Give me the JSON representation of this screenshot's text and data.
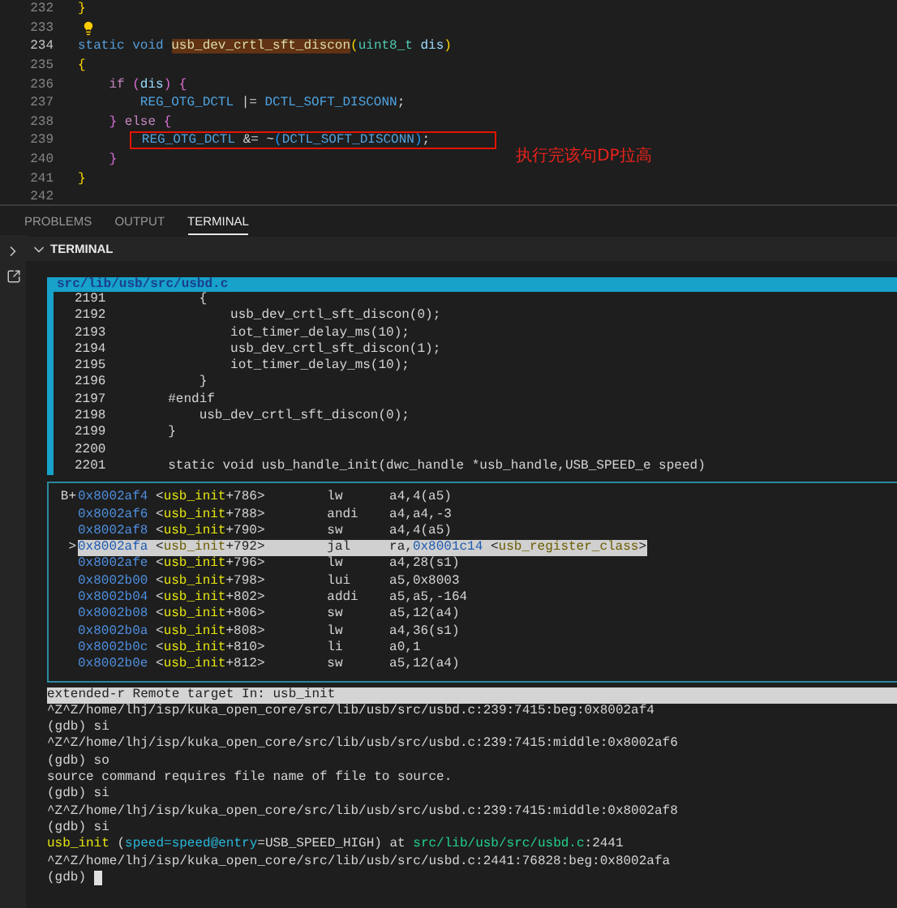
{
  "editor": {
    "lines": [
      {
        "number": "232",
        "kind": "code",
        "current": false,
        "tokens": [
          {
            "text": "}",
            "kind": "bracket1"
          }
        ]
      },
      {
        "number": "233",
        "kind": "hint",
        "current": false
      },
      {
        "number": "234",
        "kind": "code",
        "current": true,
        "tokens": [
          {
            "text": "static void ",
            "kind": "keyword"
          },
          {
            "text": "usb_dev_crtl_sft_discon",
            "kind": "function-match"
          },
          {
            "text": "(",
            "kind": "bracket1"
          },
          {
            "text": "uint8_t",
            "kind": "type"
          },
          {
            "text": " dis",
            "kind": "variable"
          },
          {
            "text": ")",
            "kind": "bracket1"
          }
        ]
      },
      {
        "number": "235",
        "kind": "code",
        "current": false,
        "tokens": [
          {
            "text": "{",
            "kind": "bracket1"
          }
        ]
      },
      {
        "number": "236",
        "kind": "code",
        "current": false,
        "tokens": [
          {
            "text": "    if",
            "kind": "control"
          },
          {
            "text": " (",
            "kind": "bracket2"
          },
          {
            "text": "dis",
            "kind": "variable"
          },
          {
            "text": ") {",
            "kind": "bracket2"
          }
        ]
      },
      {
        "number": "237",
        "kind": "code",
        "current": false,
        "tokens": [
          {
            "text": "        REG_OTG_DCTL",
            "kind": "macro"
          },
          {
            "text": " |= ",
            "kind": "plain"
          },
          {
            "text": "DCTL_SOFT_DISCONN",
            "kind": "macro"
          },
          {
            "text": ";",
            "kind": "plain"
          }
        ]
      },
      {
        "number": "238",
        "kind": "code",
        "current": false,
        "tokens": [
          {
            "text": "    }",
            "kind": "bracket2"
          },
          {
            "text": " else",
            "kind": "control"
          },
          {
            "text": " {",
            "kind": "bracket2"
          }
        ]
      },
      {
        "number": "239",
        "kind": "code",
        "current": false,
        "boxed": true,
        "note": "执行完该句DP拉高",
        "tokens": [
          {
            "text": "        REG_OTG_DCTL",
            "kind": "macro"
          },
          {
            "text": " &= ~",
            "kind": "plain"
          },
          {
            "text": "(",
            "kind": "bracket3"
          },
          {
            "text": "DCTL_SOFT_DISCONN",
            "kind": "macro"
          },
          {
            "text": ")",
            "kind": "bracket3"
          },
          {
            "text": ";",
            "kind": "plain"
          }
        ]
      },
      {
        "number": "240",
        "kind": "code",
        "current": false,
        "tokens": [
          {
            "text": "    }",
            "kind": "bracket2"
          }
        ]
      },
      {
        "number": "241",
        "kind": "code",
        "current": false,
        "tokens": [
          {
            "text": "}",
            "kind": "bracket1"
          }
        ]
      },
      {
        "number": "242",
        "kind": "code",
        "current": false
      }
    ]
  },
  "panel_tabs": [
    {
      "label": "PROBLEMS",
      "selected": false
    },
    {
      "label": "OUTPUT",
      "selected": false
    },
    {
      "label": "TERMINAL",
      "selected": true
    }
  ],
  "terminal": {
    "title": "TERMINAL",
    "source": {
      "file": "src/lib/usb/src/usbd.c",
      "lines": [
        "2191            {",
        "2192                usb_dev_crtl_sft_discon(0);",
        "2193                iot_timer_delay_ms(10);",
        "2194                usb_dev_crtl_sft_discon(1);",
        "2195                iot_timer_delay_ms(10);",
        "2196            }",
        "2197        #endif",
        "2198            usb_dev_crtl_sft_discon(0);",
        "2199        }",
        "2200",
        "2201        static void usb_handle_init(dwc_handle *usb_handle,USB_SPEED_e speed)"
      ]
    },
    "disassembly": [
      {
        "marker": "B+",
        "selected": false,
        "tokens": [
          {
            "text": "0x8002af4",
            "kind": "address"
          },
          {
            "text": " <",
            "kind": "plain"
          },
          {
            "text": "usb_init",
            "kind": "symbol"
          },
          {
            "text": "+786>        lw      a4,4(a5)",
            "kind": "plain"
          }
        ]
      },
      {
        "selected": false,
        "tokens": [
          {
            "text": "0x8002af6",
            "kind": "address"
          },
          {
            "text": " <",
            "kind": "plain"
          },
          {
            "text": "usb_init",
            "kind": "symbol"
          },
          {
            "text": "+788>        andi    a4,a4,-3",
            "kind": "plain"
          }
        ]
      },
      {
        "selected": false,
        "tokens": [
          {
            "text": "0x8002af8",
            "kind": "address"
          },
          {
            "text": " <",
            "kind": "plain"
          },
          {
            "text": "usb_init",
            "kind": "symbol"
          },
          {
            "text": "+790>        sw      a4,4(a5)",
            "kind": "plain"
          }
        ]
      },
      {
        "marker": ">",
        "selected": true,
        "tokens": [
          {
            "text": "0x8002afa",
            "kind": "address"
          },
          {
            "text": " <",
            "kind": "plain"
          },
          {
            "text": "usb_init",
            "kind": "symbol"
          },
          {
            "text": "+792>        jal     ra,",
            "kind": "plain"
          },
          {
            "text": "0x8001c14",
            "kind": "address"
          },
          {
            "text": " <",
            "kind": "plain"
          },
          {
            "text": "usb_register_class",
            "kind": "symbol"
          },
          {
            "text": ">",
            "kind": "plain"
          }
        ]
      },
      {
        "selected": false,
        "tokens": [
          {
            "text": "0x8002afe",
            "kind": "address"
          },
          {
            "text": " <",
            "kind": "plain"
          },
          {
            "text": "usb_init",
            "kind": "symbol"
          },
          {
            "text": "+796>        lw      a4,28(s1)",
            "kind": "plain"
          }
        ]
      },
      {
        "selected": false,
        "tokens": [
          {
            "text": "0x8002b00",
            "kind": "address"
          },
          {
            "text": " <",
            "kind": "plain"
          },
          {
            "text": "usb_init",
            "kind": "symbol"
          },
          {
            "text": "+798>        lui     a5,0x8003",
            "kind": "plain"
          }
        ]
      },
      {
        "selected": false,
        "tokens": [
          {
            "text": "0x8002b04",
            "kind": "address"
          },
          {
            "text": " <",
            "kind": "plain"
          },
          {
            "text": "usb_init",
            "kind": "symbol"
          },
          {
            "text": "+802>        addi    a5,a5,-164",
            "kind": "plain"
          }
        ]
      },
      {
        "selected": false,
        "tokens": [
          {
            "text": "0x8002b08",
            "kind": "address"
          },
          {
            "text": " <",
            "kind": "plain"
          },
          {
            "text": "usb_init",
            "kind": "symbol"
          },
          {
            "text": "+806>        sw      a5,12(a4)",
            "kind": "plain"
          }
        ]
      },
      {
        "selected": false,
        "tokens": [
          {
            "text": "0x8002b0a",
            "kind": "address"
          },
          {
            "text": " <",
            "kind": "plain"
          },
          {
            "text": "usb_init",
            "kind": "symbol"
          },
          {
            "text": "+808>        lw      a4,36(s1)",
            "kind": "plain"
          }
        ]
      },
      {
        "selected": false,
        "tokens": [
          {
            "text": "0x8002b0c",
            "kind": "address"
          },
          {
            "text": " <",
            "kind": "plain"
          },
          {
            "text": "usb_init",
            "kind": "symbol"
          },
          {
            "text": "+810>        li      a0,1",
            "kind": "plain"
          }
        ]
      },
      {
        "selected": false,
        "tokens": [
          {
            "text": "0x8002b0e",
            "kind": "address"
          },
          {
            "text": " <",
            "kind": "plain"
          },
          {
            "text": "usb_init",
            "kind": "symbol"
          },
          {
            "text": "+812>        sw      a5,12(a4)",
            "kind": "plain"
          }
        ]
      }
    ],
    "status": "extended-r Remote target In: usb_init",
    "output": [
      {
        "kind": "text",
        "tokens": [
          {
            "text": "^Z^Z/home/lhj/isp/kuka_open_core/src/lib/usb/src/usbd.c:239:7415:beg:0x8002af4",
            "kind": "plain"
          }
        ]
      },
      {
        "kind": "text",
        "tokens": [
          {
            "text": "(gdb) si",
            "kind": "plain"
          }
        ]
      },
      {
        "kind": "text",
        "tokens": [
          {
            "text": "^Z^Z/home/lhj/isp/kuka_open_core/src/lib/usb/src/usbd.c:239:7415:middle:0x8002af6",
            "kind": "plain"
          }
        ]
      },
      {
        "kind": "text",
        "tokens": [
          {
            "text": "(gdb) so",
            "kind": "plain"
          }
        ]
      },
      {
        "kind": "text",
        "tokens": [
          {
            "text": "source command requires file name of file to source.",
            "kind": "plain"
          }
        ]
      },
      {
        "kind": "text",
        "tokens": [
          {
            "text": "(gdb) si",
            "kind": "plain"
          }
        ]
      },
      {
        "kind": "text",
        "tokens": [
          {
            "text": "^Z^Z/home/lhj/isp/kuka_open_core/src/lib/usb/src/usbd.c:239:7415:middle:0x8002af8",
            "kind": "plain"
          }
        ]
      },
      {
        "kind": "text",
        "tokens": [
          {
            "text": "(gdb) si",
            "kind": "plain"
          }
        ]
      },
      {
        "kind": "text",
        "tokens": [
          {
            "text": "usb_init",
            "kind": "symbol"
          },
          {
            "text": " (",
            "kind": "plain"
          },
          {
            "text": "speed=speed@entry",
            "kind": "param"
          },
          {
            "text": "=USB_SPEED_HIGH) at ",
            "kind": "plain"
          },
          {
            "text": "src/lib/usb/src/usbd.c",
            "kind": "path"
          },
          {
            "text": ":2441",
            "kind": "plain"
          }
        ]
      },
      {
        "kind": "text",
        "tokens": [
          {
            "text": "^Z^Z/home/lhj/isp/kuka_open_core/src/lib/usb/src/usbd.c:2441:76828:beg:0x8002afa",
            "kind": "plain"
          }
        ]
      },
      {
        "kind": "prompt",
        "tokens": [
          {
            "text": "(gdb) ",
            "kind": "plain"
          }
        ]
      }
    ]
  }
}
